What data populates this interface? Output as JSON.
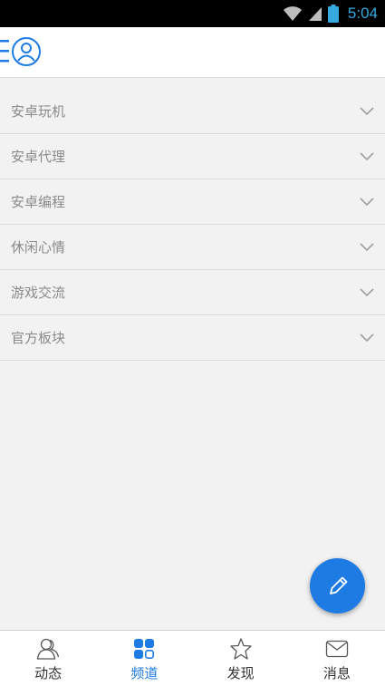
{
  "status_bar": {
    "time": "5:04",
    "icons": [
      "wifi-icon",
      "signal-icon",
      "battery-icon"
    ]
  },
  "header": {
    "profile_icon": "profile-menu-icon",
    "accent_color": "#1e7be3"
  },
  "channels": [
    {
      "label": "安卓玩机"
    },
    {
      "label": "安卓代理"
    },
    {
      "label": "安卓编程"
    },
    {
      "label": "休闲心情"
    },
    {
      "label": "游戏交流"
    },
    {
      "label": "官方板块"
    }
  ],
  "fab": {
    "icon": "pencil-icon"
  },
  "bottom_nav": {
    "items": [
      {
        "label": "动态",
        "icon": "people-icon",
        "active": false
      },
      {
        "label": "频道",
        "icon": "grid-icon",
        "active": true
      },
      {
        "label": "发现",
        "icon": "star-icon",
        "active": false
      },
      {
        "label": "消息",
        "icon": "mail-icon",
        "active": false
      }
    ],
    "active_color": "#1e7be3"
  }
}
